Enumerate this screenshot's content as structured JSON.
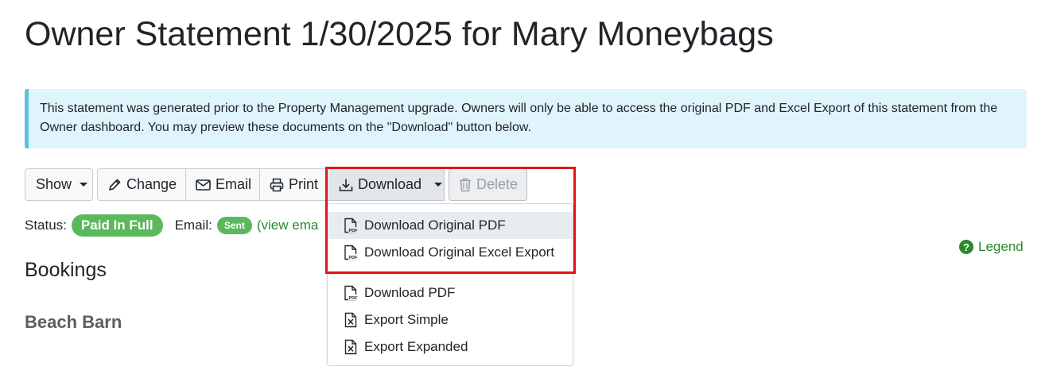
{
  "page": {
    "title": "Owner Statement 1/30/2025 for Mary Moneybags"
  },
  "alert": {
    "text": "This statement was generated prior to the Property Management upgrade. Owners will only be able to access the original PDF and Excel Export of this statement from the Owner dashboard. You may preview these documents on the \"Download\" button below."
  },
  "toolbar": {
    "show_label": "Show",
    "change_label": "Change",
    "email_label": "Email",
    "print_label": "Print",
    "download_label": "Download",
    "delete_label": "Delete"
  },
  "status": {
    "label": "Status:",
    "badge": "Paid In Full",
    "email_label": "Email:",
    "email_badge": "Sent",
    "view_link": "(view ema"
  },
  "legend": {
    "label": "Legend",
    "icon": "?"
  },
  "sections": {
    "bookings": "Bookings",
    "property": "Beach Barn"
  },
  "download_menu": {
    "items": [
      {
        "label": "Download Original PDF",
        "icon": "pdf-file-icon"
      },
      {
        "label": "Download Original Excel Export",
        "icon": "pdf-file-icon"
      },
      {
        "label": "Download PDF",
        "icon": "pdf-file-icon"
      },
      {
        "label": "Export Simple",
        "icon": "excel-file-icon"
      },
      {
        "label": "Export Expanded",
        "icon": "excel-file-icon"
      }
    ]
  },
  "colors": {
    "highlight": "#e3151a",
    "badge_green": "#5cb85c",
    "link_green": "#2a8a2a",
    "alert_bg": "#e0f4fb",
    "alert_border": "#5bc0de"
  }
}
